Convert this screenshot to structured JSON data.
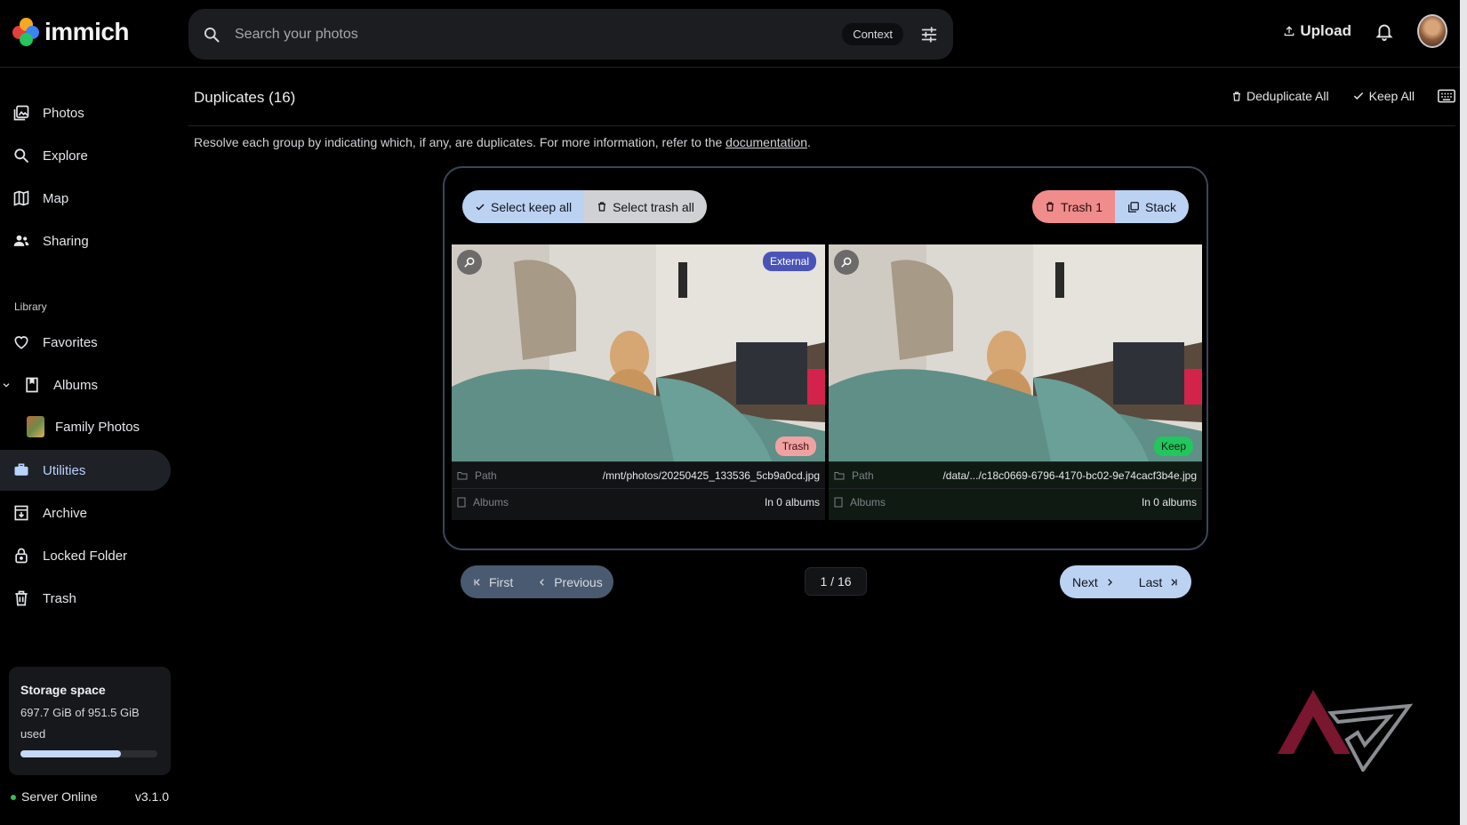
{
  "app": {
    "name": "immich"
  },
  "search": {
    "placeholder": "Search your photos",
    "context_label": "Context"
  },
  "topbar": {
    "upload_label": "Upload"
  },
  "sidebar": {
    "items": [
      {
        "label": "Photos",
        "icon": "photos-icon"
      },
      {
        "label": "Explore",
        "icon": "search-icon"
      },
      {
        "label": "Map",
        "icon": "map-icon"
      },
      {
        "label": "Sharing",
        "icon": "people-icon"
      }
    ],
    "library_label": "Library",
    "library_items": [
      {
        "label": "Favorites",
        "icon": "heart-icon"
      },
      {
        "label": "Albums",
        "icon": "album-icon"
      },
      {
        "label": "Family Photos",
        "icon": "album-thumbnail"
      },
      {
        "label": "Utilities",
        "icon": "toolbox-icon",
        "active": true
      },
      {
        "label": "Archive",
        "icon": "archive-icon"
      },
      {
        "label": "Locked Folder",
        "icon": "lock-icon"
      },
      {
        "label": "Trash",
        "icon": "trash-icon"
      }
    ],
    "storage": {
      "title": "Storage space",
      "used_text": "697.7 GiB of 951.5 GiB used",
      "used_fraction": 0.733
    },
    "server": {
      "status": "Server Online",
      "version": "v3.1.0"
    }
  },
  "page": {
    "title": "Duplicates (16)",
    "actions": {
      "deduplicate_all": "Deduplicate All",
      "keep_all": "Keep All"
    },
    "description_prefix": "Resolve each group by indicating which, if any, are duplicates. For more information, refer to the ",
    "description_link": "documentation",
    "description_suffix": "."
  },
  "group": {
    "select_keep_all": "Select keep all",
    "select_trash_all": "Select trash all",
    "trash_button": "Trash 1",
    "stack_button": "Stack",
    "assets": [
      {
        "badge_top": "External",
        "status": "Trash",
        "path_label": "Path",
        "path": "/mnt/photos/20250425_133536_5cb9a0cd.jpg",
        "albums_label": "Albums",
        "albums": "In 0 albums"
      },
      {
        "badge_top": "",
        "status": "Keep",
        "path_label": "Path",
        "path": "/data/.../c18c0669-6796-4170-bc02-9e74cacf3b4e.jpg",
        "albums_label": "Albums",
        "albums": "In 0 albums"
      }
    ]
  },
  "pagination": {
    "first": "First",
    "previous": "Previous",
    "current": "1 / 16",
    "next": "Next",
    "last": "Last"
  },
  "colors": {
    "accent": "#bcd2f3",
    "danger": "#f08c8c",
    "keep": "#22c55e",
    "external_badge": "#4a54b8"
  }
}
